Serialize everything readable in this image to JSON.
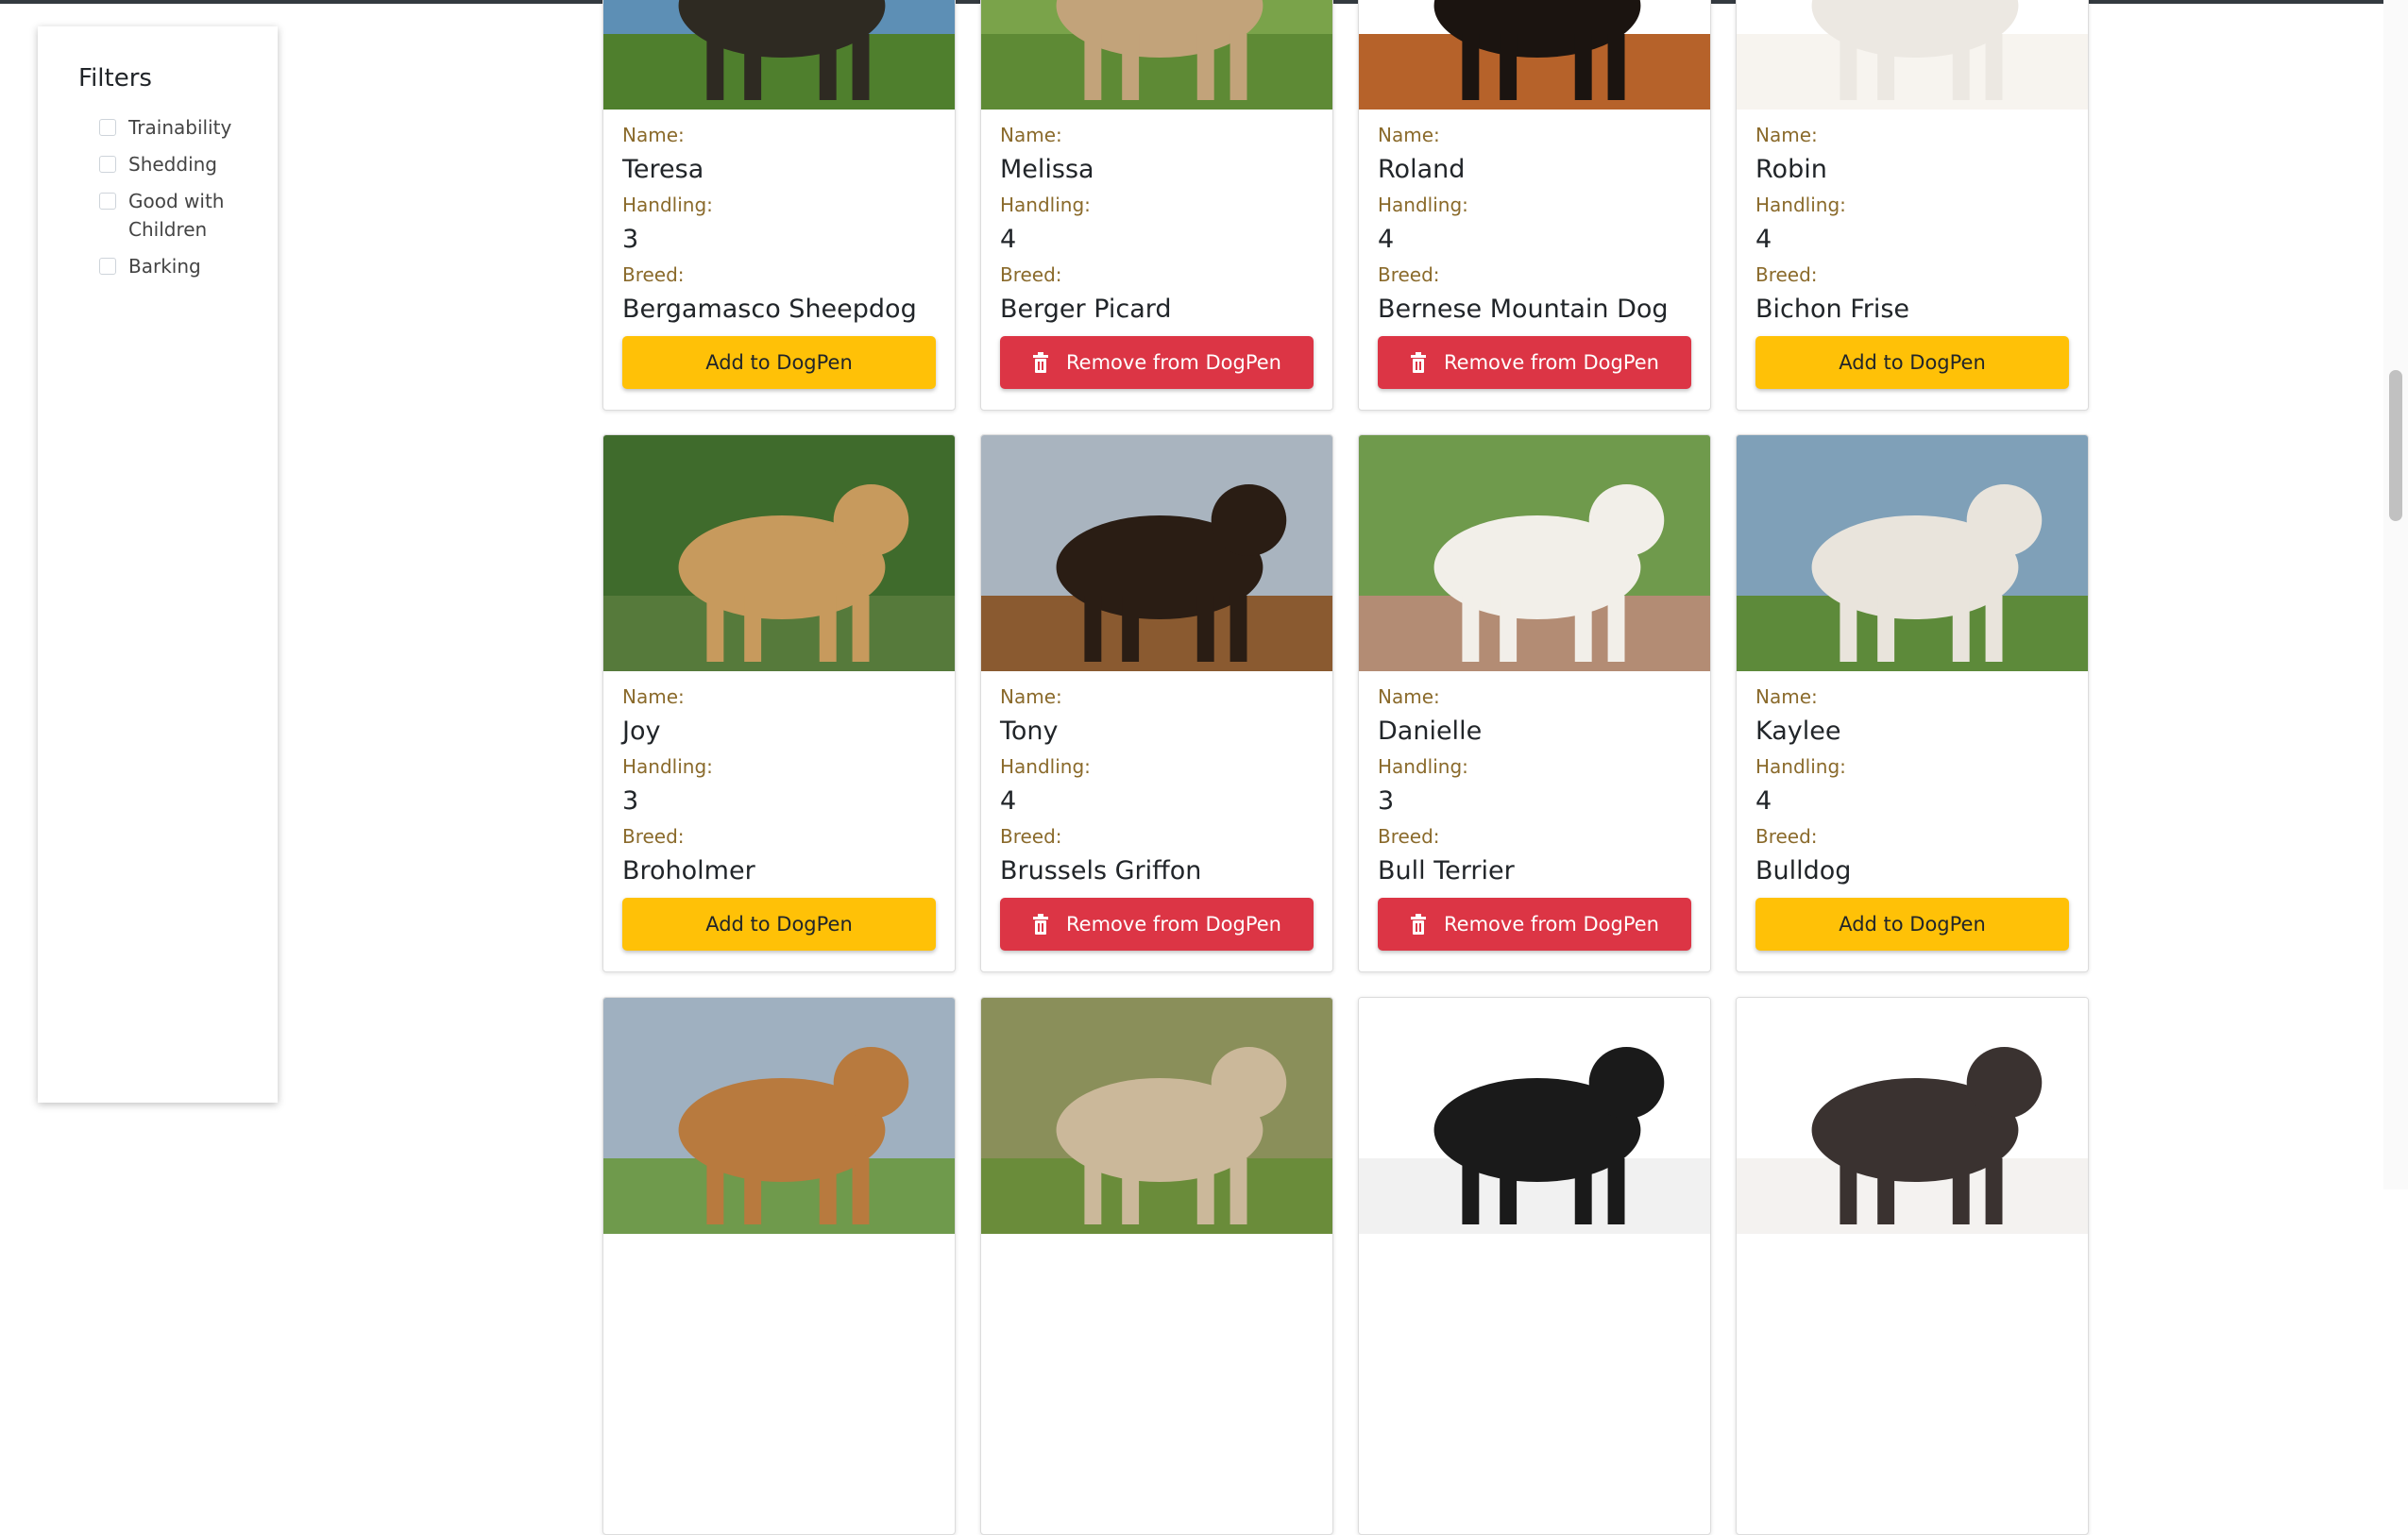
{
  "sidebar": {
    "title": "Filters",
    "filters": [
      "Trainability",
      "Shedding",
      "Good with Children",
      "Barking"
    ]
  },
  "labels": {
    "name": "Name:",
    "handling": "Handling:",
    "breed": "Breed:"
  },
  "buttons": {
    "add": "Add to DogPen",
    "remove": "Remove from DogPen"
  },
  "dogs": [
    {
      "name": "Teresa",
      "handling": "3",
      "breed": "Bergamasco Sheepdog",
      "in_pen": false,
      "photo_colors": [
        "#5d8fb5",
        "#2e2a22",
        "#4f7f2d"
      ]
    },
    {
      "name": "Melissa",
      "handling": "4",
      "breed": "Berger Picard",
      "in_pen": true,
      "photo_colors": [
        "#7aa34a",
        "#c2a37a",
        "#5e8a35"
      ]
    },
    {
      "name": "Roland",
      "handling": "4",
      "breed": "Bernese Mountain Dog",
      "in_pen": true,
      "photo_colors": [
        "#ffffff",
        "#1b1410",
        "#b6622a"
      ]
    },
    {
      "name": "Robin",
      "handling": "4",
      "breed": "Bichon Frise",
      "in_pen": false,
      "photo_colors": [
        "#ffffff",
        "#ece8e2",
        "#f7f4ef"
      ]
    },
    {
      "name": "Joy",
      "handling": "3",
      "breed": "Broholmer",
      "in_pen": false,
      "photo_colors": [
        "#3f6b2c",
        "#c79a5d",
        "#567a3b"
      ]
    },
    {
      "name": "Tony",
      "handling": "4",
      "breed": "Brussels Griffon",
      "in_pen": true,
      "photo_colors": [
        "#a9b4bf",
        "#2a1d14",
        "#8a5a30"
      ]
    },
    {
      "name": "Danielle",
      "handling": "3",
      "breed": "Bull Terrier",
      "in_pen": true,
      "photo_colors": [
        "#6f9a4c",
        "#f2efe9",
        "#b38c74"
      ]
    },
    {
      "name": "Kaylee",
      "handling": "4",
      "breed": "Bulldog",
      "in_pen": false,
      "photo_colors": [
        "#7fa0b8",
        "#e9e4dc",
        "#5d8a3a"
      ]
    },
    {
      "name": "",
      "handling": "",
      "breed": "",
      "in_pen": false,
      "photo_colors": [
        "#9fb0c0",
        "#b87a3e",
        "#6f9a4c"
      ]
    },
    {
      "name": "",
      "handling": "",
      "breed": "",
      "in_pen": false,
      "photo_colors": [
        "#8a8f5a",
        "#cbb89a",
        "#6a8c3a"
      ]
    },
    {
      "name": "",
      "handling": "",
      "breed": "",
      "in_pen": false,
      "photo_colors": [
        "#ffffff",
        "#1a1a1a",
        "#f1f1f1"
      ]
    },
    {
      "name": "",
      "handling": "",
      "breed": "",
      "in_pen": false,
      "photo_colors": [
        "#ffffff",
        "#3a3230",
        "#f4f2f0"
      ]
    }
  ]
}
